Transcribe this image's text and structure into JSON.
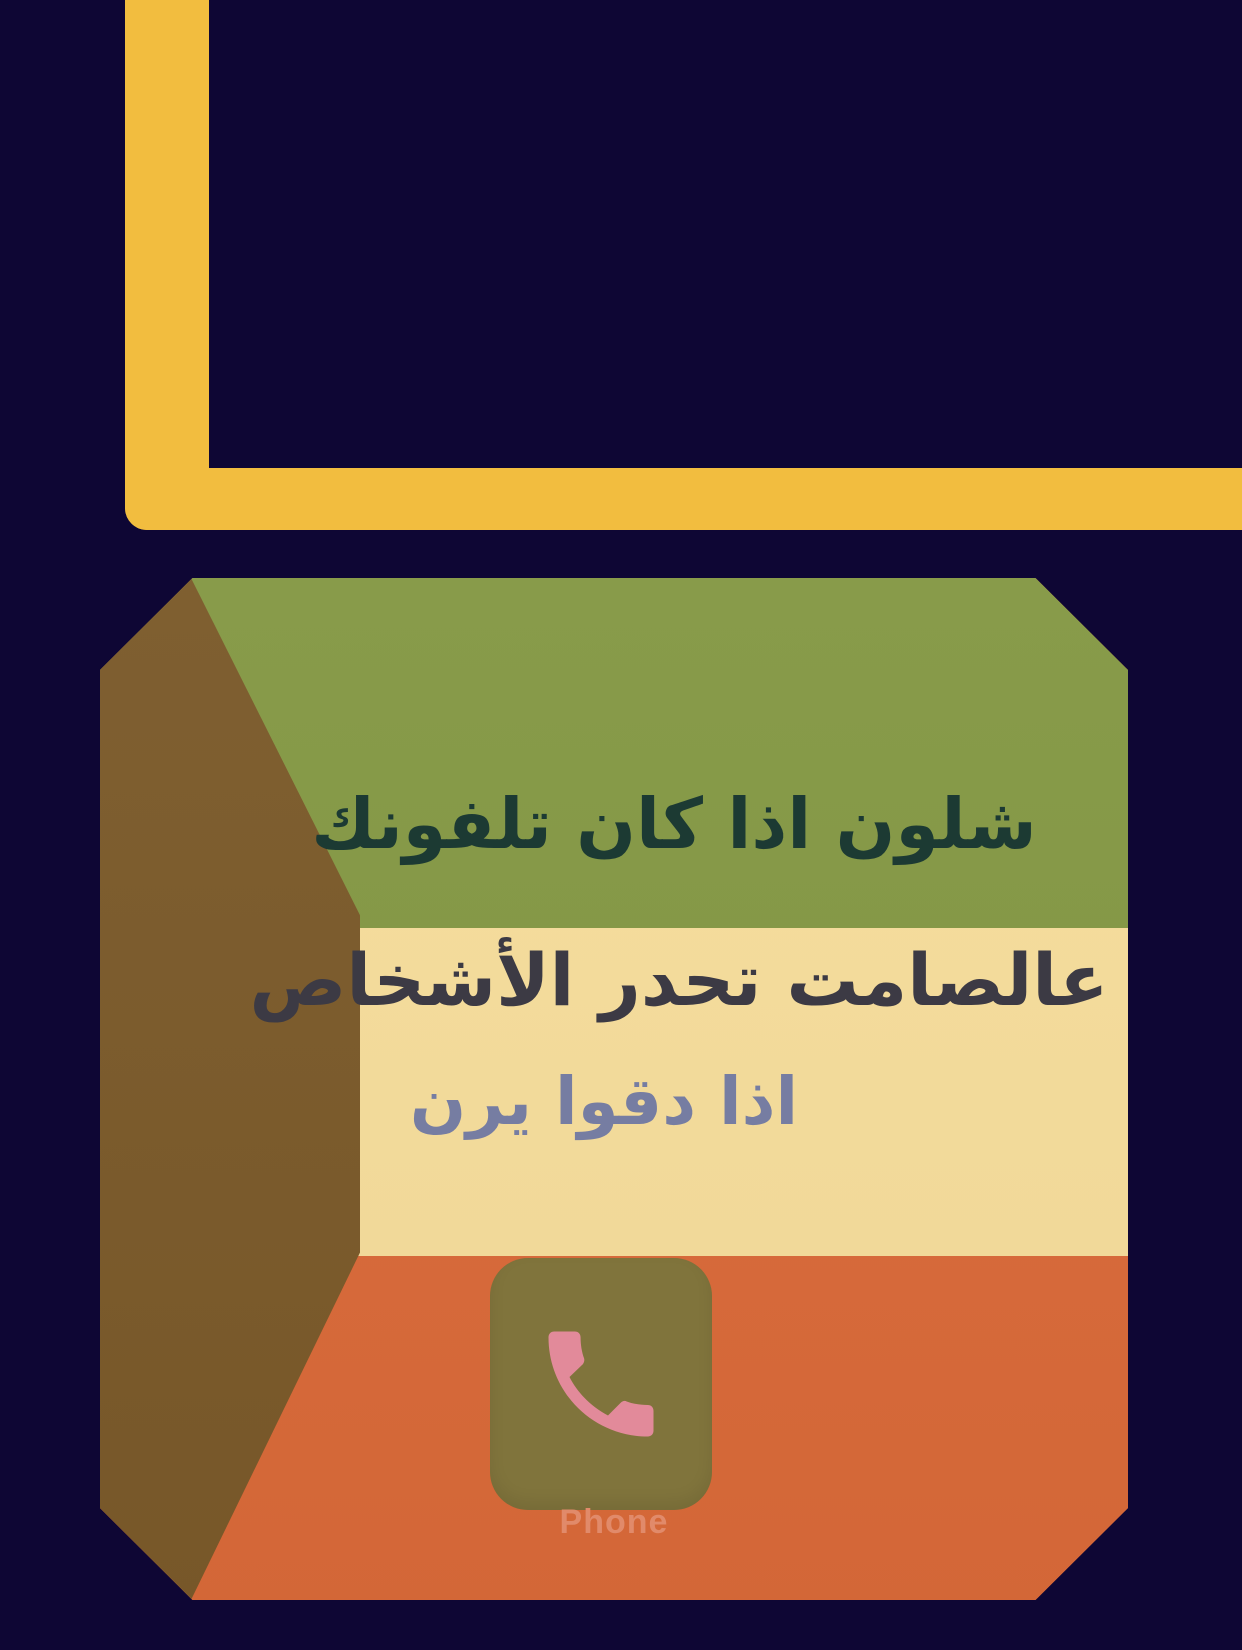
{
  "colors": {
    "background": "#0e0634",
    "frame": "#f2bd3f",
    "green": "#849844",
    "cream": "#f6dd9b",
    "orange": "#da6a39",
    "trapezoid": "#7b5a2a",
    "phone_icon_bg": "#80743c",
    "phone_glyph": "#e28a9a"
  },
  "card": {
    "lines": [
      "شلون اذا كان تلفونك",
      "عالصامت تحدر الأشخاص",
      "اذا دقوا يرن"
    ],
    "app": {
      "icon": "phone-icon",
      "label": "Phone"
    }
  }
}
